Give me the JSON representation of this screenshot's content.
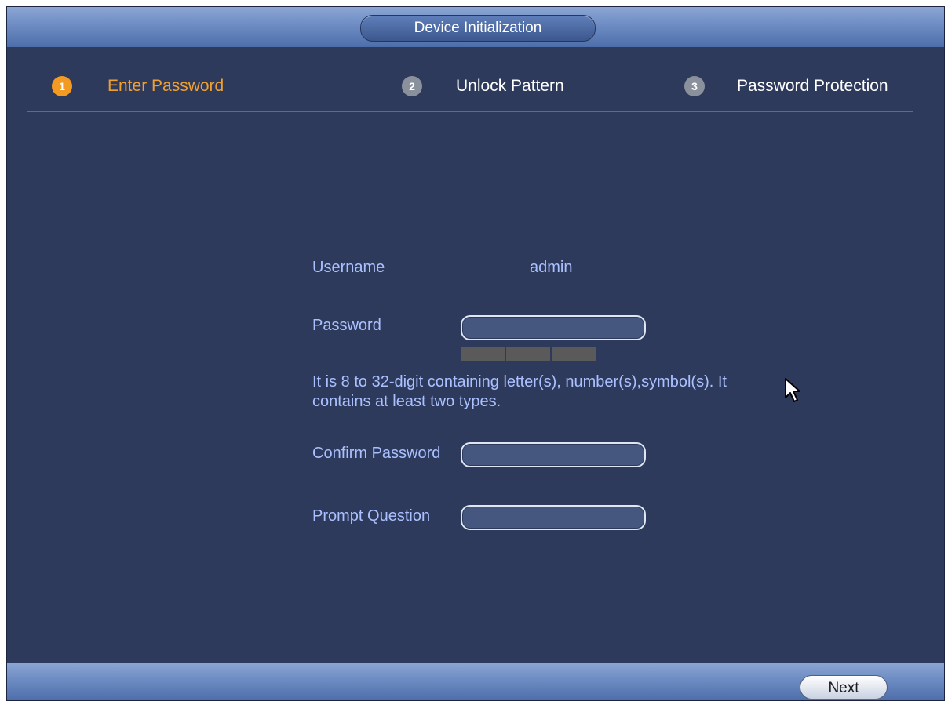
{
  "window": {
    "title": "Device Initialization"
  },
  "steps": [
    {
      "number": "1",
      "label": "Enter Password",
      "state": "active"
    },
    {
      "number": "2",
      "label": "Unlock Pattern",
      "state": "inactive"
    },
    {
      "number": "3",
      "label": "Password Protection",
      "state": "inactive"
    }
  ],
  "form": {
    "username_label": "Username",
    "username_value": "admin",
    "password_label": "Password",
    "password_value": "",
    "password_hint": "It is 8 to 32-digit containing letter(s), number(s),symbol(s). It contains at least two types.",
    "confirm_label": "Confirm Password",
    "confirm_value": "",
    "prompt_label": "Prompt Question",
    "prompt_value": ""
  },
  "footer": {
    "next_label": "Next"
  },
  "icons": {
    "cursor": "mouse-pointer-icon"
  },
  "colors": {
    "background": "#2e3a5c",
    "active_step": "#f29a22",
    "inactive_step": "#8b919c",
    "label_text": "#aac0ff"
  }
}
